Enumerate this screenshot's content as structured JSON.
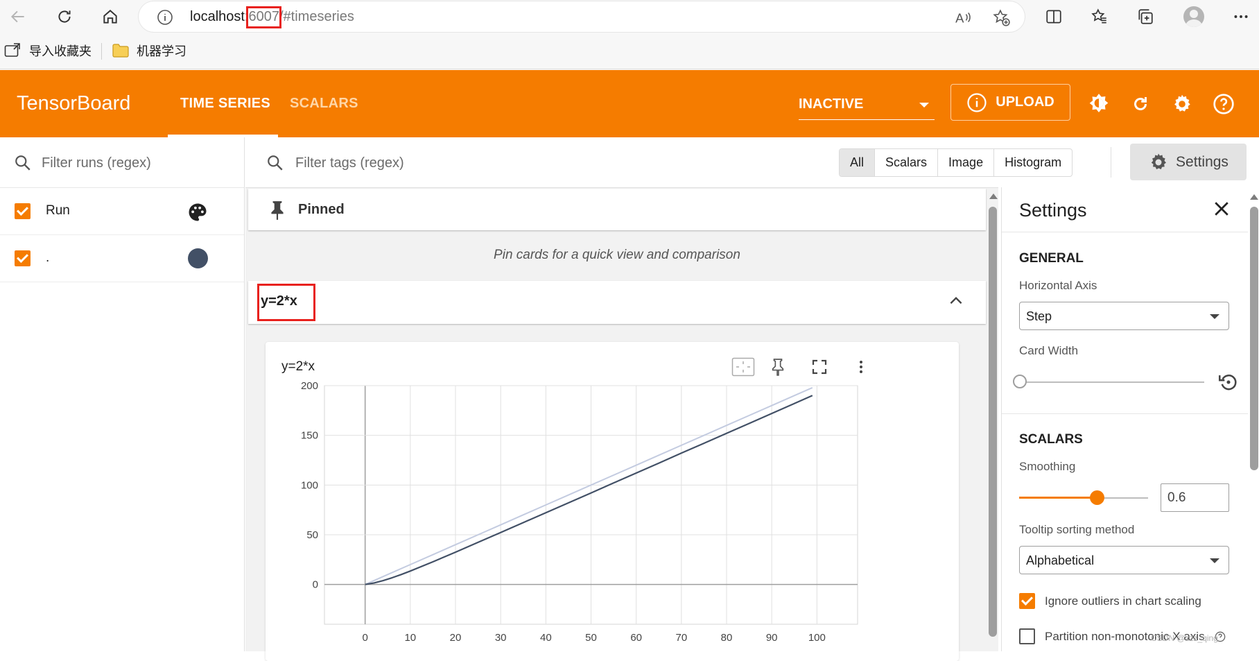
{
  "browser": {
    "url_host": "localhost:",
    "url_port": "6007",
    "url_rest": "/#timeseries",
    "favorites": [
      {
        "label": "导入收藏夹",
        "icon": "import-icon"
      },
      {
        "label": "机器学习",
        "icon": "folder-icon"
      }
    ]
  },
  "header": {
    "brand": "TensorBoard",
    "tabs": [
      {
        "label": "TIME SERIES",
        "active": true
      },
      {
        "label": "SCALARS",
        "active": false
      }
    ],
    "plugin_select": "INACTIVE",
    "upload_label": "UPLOAD",
    "accent_color": "#f57c00"
  },
  "runs": {
    "filter_placeholder": "Filter runs (regex)",
    "items": [
      {
        "name": "Run",
        "checked": true,
        "swatch": "palette-icon"
      },
      {
        "name": ".",
        "checked": true,
        "color": "#425066"
      }
    ]
  },
  "main": {
    "filter_placeholder": "Filter tags (regex)",
    "type_filters": [
      "All",
      "Scalars",
      "Image",
      "Histogram"
    ],
    "settings_label": "Settings",
    "pinned_label": "Pinned",
    "pinned_empty": "Pin cards for a quick view and comparison",
    "group_name": "y=2*x",
    "card": {
      "title": "y=2*x"
    }
  },
  "settings": {
    "title": "Settings",
    "general": "GENERAL",
    "horizontal_axis_label": "Horizontal Axis",
    "horizontal_axis_value": "Step",
    "card_width_label": "Card Width",
    "card_width_level": 0,
    "scalars": "SCALARS",
    "smoothing_label": "Smoothing",
    "smoothing_value": "0.6",
    "tooltip_label": "Tooltip sorting method",
    "tooltip_value": "Alphabetical",
    "ignore_outliers_label": "Ignore outliers in chart scaling",
    "ignore_outliers_checked": true,
    "partition_label": "Partition non-monotonic X axis",
    "partition_checked": false
  },
  "watermark": "CSDN @zzz_qing",
  "chart_data": {
    "type": "line",
    "title": "y=2*x",
    "xlabel": "",
    "ylabel": "",
    "xlim": [
      -9,
      109
    ],
    "ylim": [
      -40,
      200
    ],
    "x_ticks": [
      0,
      10,
      20,
      30,
      40,
      50,
      60,
      70,
      80,
      90,
      100
    ],
    "y_ticks": [
      0,
      50,
      100,
      150,
      200
    ],
    "grid": true,
    "series": [
      {
        "color": "#c3cbe0",
        "x": [
          0,
          5,
          10,
          15,
          20,
          25,
          30,
          35,
          40,
          45,
          50,
          55,
          60,
          65,
          70,
          75,
          80,
          85,
          90,
          95,
          99
        ],
        "y": [
          0,
          10,
          20,
          30,
          40,
          50,
          60,
          70,
          80,
          90,
          100,
          110,
          120,
          130,
          140,
          150,
          160,
          170,
          180,
          190,
          198
        ]
      },
      {
        "color": "#425066",
        "x": [
          0,
          2,
          4,
          6,
          8,
          10,
          15,
          20,
          25,
          30,
          35,
          40,
          45,
          50,
          55,
          60,
          65,
          70,
          75,
          80,
          85,
          90,
          95,
          99
        ],
        "y": [
          0,
          1.6,
          3.9,
          6.8,
          10,
          13.5,
          22.8,
          32.5,
          42.4,
          52.3,
          62.2,
          72.2,
          82.1,
          92.1,
          102.1,
          112.1,
          122.1,
          132.1,
          142,
          152,
          162,
          172,
          182,
          190
        ]
      }
    ]
  }
}
